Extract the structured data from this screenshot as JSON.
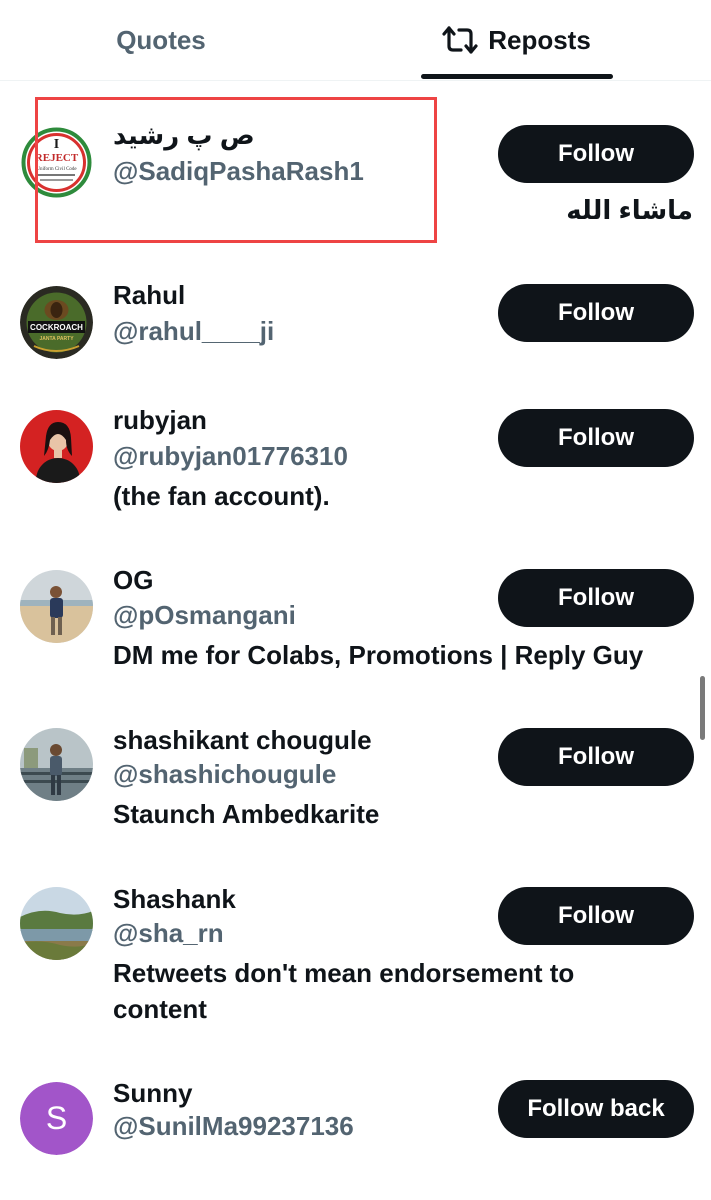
{
  "tabs": {
    "quotes": "Quotes",
    "reposts": "Reposts",
    "reposts_icon": "repost-icon"
  },
  "users": [
    {
      "name": "ص پ رشید",
      "handle": "@SadiqPashaRash1",
      "bio": "ماشاء الله",
      "button": "Follow",
      "avatar": "reject-ucc-logo",
      "avatar_text": [
        "I",
        "REJECT",
        "Uniform Civil Code"
      ]
    },
    {
      "name": "Rahul",
      "handle": "@rahul____ji",
      "bio": "",
      "button": "Follow",
      "avatar": "cockroach-logo",
      "avatar_text": [
        "COCKROACH",
        "JANTA PARTY"
      ]
    },
    {
      "name": "rubyjan",
      "handle": "@rubyjan01776310",
      "bio": "(the fan account).",
      "button": "Follow",
      "avatar": "photo-woman-red"
    },
    {
      "name": "OG",
      "handle": "@pOsmangani",
      "bio": "DM me for Colabs, Promotions | Reply Guy",
      "button": "Follow",
      "avatar": "photo-man-beach"
    },
    {
      "name": "shashikant chougule",
      "handle": "@shashichougule",
      "bio": "Staunch Ambedkarite",
      "button": "Follow",
      "avatar": "photo-man-railing"
    },
    {
      "name": "Shashank",
      "handle": "@sha_rn",
      "bio": "Retweets don't mean endorsement to content",
      "button": "Follow",
      "avatar": "photo-landscape"
    },
    {
      "name": "Sunny",
      "handle": "@SunilMa99237136",
      "bio": "",
      "button": "Follow back",
      "avatar": "letter-avatar",
      "avatar_letter": "S"
    }
  ],
  "colors": {
    "text": "#0f1419",
    "secondary": "#536471",
    "button_bg": "#0f1419",
    "button_text": "#ffffff",
    "highlight": "#ee4444",
    "letter_avatar": "#a255c9"
  }
}
